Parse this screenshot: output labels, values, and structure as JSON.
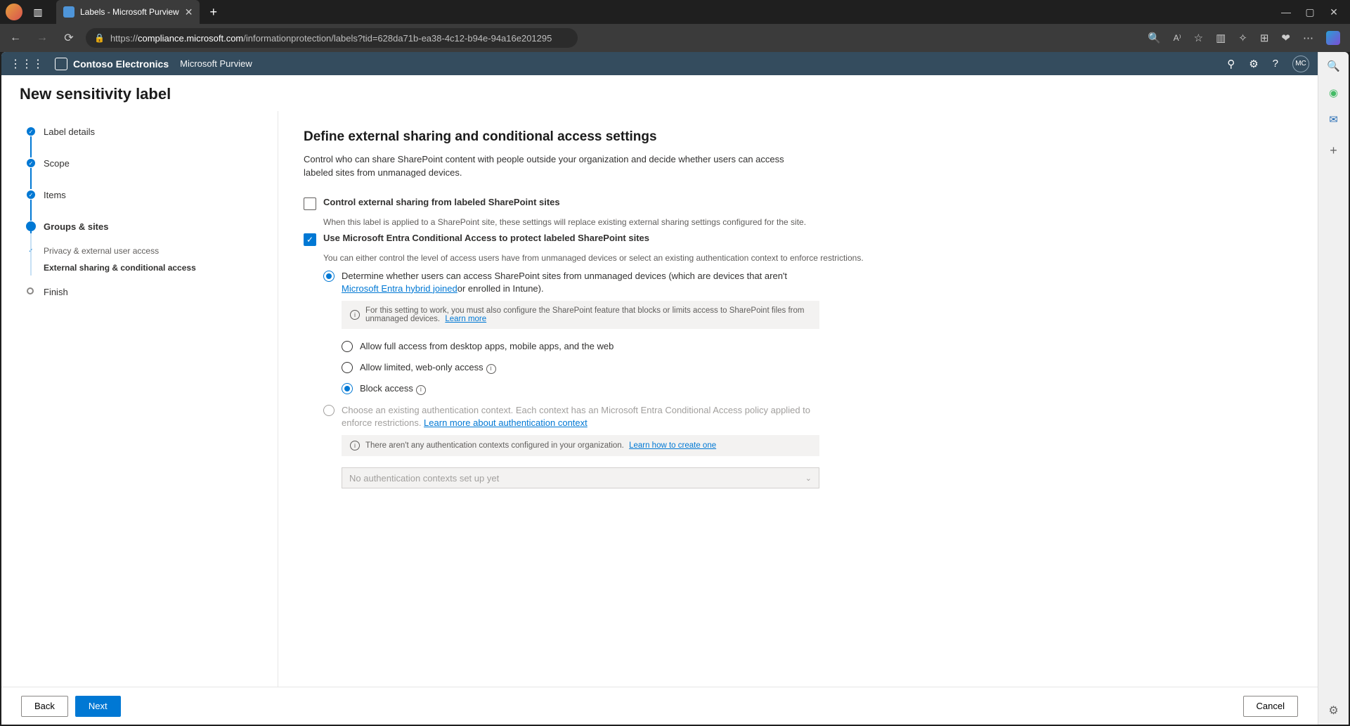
{
  "browser": {
    "tab_title": "Labels - Microsoft Purview",
    "url_prefix": "https://",
    "url_host": "compliance.microsoft.com",
    "url_path": "/informationprotection/labels?tid=628da71b-ea38-4c12-b94e-94a16e201295"
  },
  "suite": {
    "org": "Contoso Electronics",
    "product": "Microsoft Purview",
    "avatar": "MC"
  },
  "page": {
    "title": "New sensitivity label"
  },
  "nav": {
    "steps": {
      "label_details": "Label details",
      "scope": "Scope",
      "items": "Items",
      "groups_sites": "Groups & sites",
      "sub_privacy": "Privacy & external user access",
      "sub_external": "External sharing & conditional access",
      "finish": "Finish"
    }
  },
  "content": {
    "heading": "Define external sharing and conditional access settings",
    "description": "Control who can share SharePoint content with people outside your organization and decide whether users can access labeled sites from unmanaged devices.",
    "chk1_title": "Control external sharing from labeled SharePoint sites",
    "chk1_help": "When this label is applied to a SharePoint site, these settings will replace existing external sharing settings configured for the site.",
    "chk2_title": "Use Microsoft Entra Conditional Access to protect labeled SharePoint sites",
    "chk2_help": "You can either control the level of access users have from unmanaged devices or select an existing authentication context to enforce restrictions.",
    "radio1_pre": "Determine whether users can access SharePoint sites from unmanaged devices (which are devices that aren't ",
    "radio1_link": "Microsoft Entra hybrid joined",
    "radio1_post": "or enrolled in Intune).",
    "banner1_text": "For this setting to work, you must also configure the SharePoint feature that blocks or limits access to SharePoint files from unmanaged devices.",
    "banner1_link": "Learn more",
    "access_full": "Allow full access from desktop apps, mobile apps, and the web",
    "access_limited": "Allow limited, web-only access",
    "access_block": "Block access",
    "radio2_pre": "Choose an existing authentication context. Each context has an Microsoft Entra Conditional Access policy applied to enforce restrictions. ",
    "radio2_link": "Learn more about authentication context",
    "banner2_text": "There aren't any authentication contexts configured in your organization.",
    "banner2_link": "Learn how to create one",
    "dropdown_placeholder": "No authentication contexts set up yet"
  },
  "footer": {
    "back": "Back",
    "next": "Next",
    "cancel": "Cancel"
  }
}
